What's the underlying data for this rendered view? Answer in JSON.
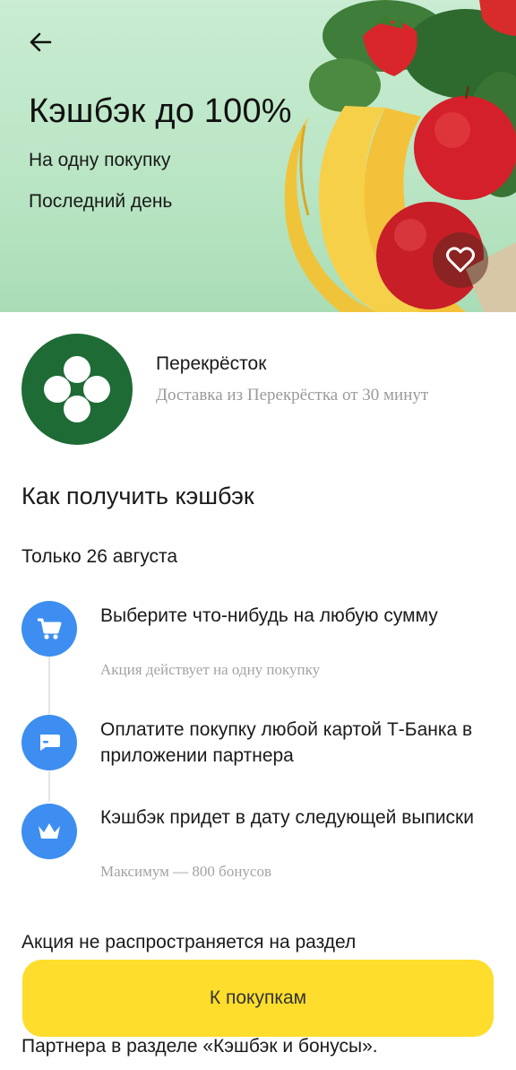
{
  "hero": {
    "title": "Кэшбэк до 100%",
    "subtitle_1": "На одну покупку",
    "subtitle_2": "Последний день",
    "back_icon": "arrow-left-icon",
    "favorite_icon": "heart-outline-icon"
  },
  "partner": {
    "name": "Перекрёсток",
    "description": "Доставка из Перекрёстка от 30 минут",
    "logo_color": "#1e6b35"
  },
  "how_to": {
    "title": "Как получить кэшбэк",
    "date": "Только 26 августа",
    "steps": [
      {
        "icon": "cart-icon",
        "title": "Выберите что-нибудь на любую сумму",
        "note": "Акция действует на одну покупку"
      },
      {
        "icon": "card-icon",
        "title": "Оплатите покупку любой картой Т-Банка в приложении партнера",
        "note": ""
      },
      {
        "icon": "crown-icon",
        "title": "Кэшбэк придет в дату следующей выписки",
        "note": "Максимум — 800 бонусов"
      }
    ]
  },
  "disclaimer": {
    "top": "Акция не распространяется на раздел",
    "bottom": "Партнера в разделе «Кэшбэк и бонусы»."
  },
  "cta": {
    "label": "К покупкам",
    "color": "#fedd2c"
  },
  "colors": {
    "accent_blue": "#3d8ef0"
  }
}
